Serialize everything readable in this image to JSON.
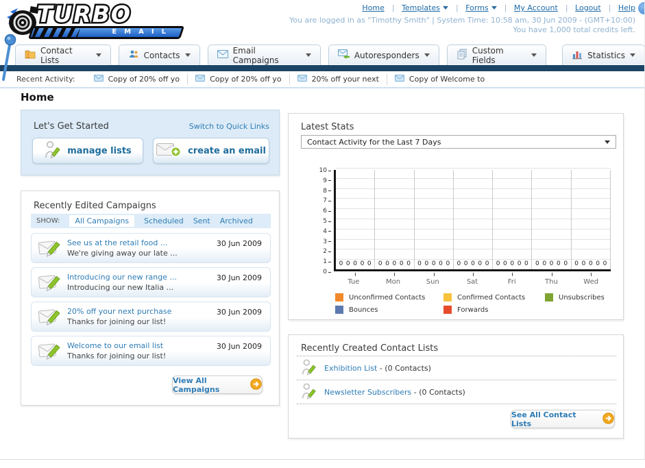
{
  "header": {
    "logo": {
      "line1": "TURBO",
      "line2": "EMAIL"
    },
    "nav": [
      {
        "label": "Home",
        "dropdown": false
      },
      {
        "label": "Templates",
        "dropdown": true
      },
      {
        "label": "Forms",
        "dropdown": true
      },
      {
        "label": "My Account",
        "dropdown": false
      },
      {
        "label": "Logout",
        "dropdown": false
      },
      {
        "label": "Help",
        "dropdown": false
      }
    ],
    "login_info": "You are logged in as \"Timothy Smith\" | System Time: 10:58 am, 30 Jun 2009 - (GMT+10:00)",
    "credits_info": "You have 1,000 total credits left."
  },
  "tabs": [
    {
      "label": "Contact Lists"
    },
    {
      "label": "Contacts"
    },
    {
      "label": "Email Campaigns"
    },
    {
      "label": "Autoresponders"
    },
    {
      "label": "Custom Fields"
    },
    {
      "label": "Statistics"
    }
  ],
  "recent_activity": {
    "label": "Recent Activity:",
    "items": [
      {
        "text": "Copy of 20% off yo"
      },
      {
        "text": "Copy of 20% off yo"
      },
      {
        "text": "20% off your next"
      },
      {
        "text": "Copy of Welcome to"
      }
    ]
  },
  "page_title": "Home",
  "get_started": {
    "title": "Let's Get Started",
    "switch_link": "Switch to Quick Links",
    "manage_lists_label": "manage lists",
    "create_email_label": "create an email"
  },
  "campaigns": {
    "title": "Recently Edited Campaigns",
    "show_label": "SHOW:",
    "filters": [
      {
        "label": "All Campaigns"
      },
      {
        "label": "Scheduled"
      },
      {
        "label": "Sent"
      },
      {
        "label": "Archived"
      }
    ],
    "items": [
      {
        "title": "See us at the retail food ...",
        "subtitle": "We're giving away our late ...",
        "date": "30 Jun 2009"
      },
      {
        "title": "Introducing our new range ...",
        "subtitle": "Introducing our new Italia ...",
        "date": "30 Jun 2009"
      },
      {
        "title": "20% off your next purchase",
        "subtitle": "Thanks for joining our list!",
        "date": "30 Jun 2009"
      },
      {
        "title": "Welcome to our email list",
        "subtitle": "Thanks for joining our list!",
        "date": "30 Jun 2009"
      }
    ],
    "view_all_label": "View All Campaigns"
  },
  "latest_stats": {
    "title": "Latest Stats",
    "dropdown_value": "Contact Activity for the Last 7 Days"
  },
  "chart_data": {
    "type": "bar",
    "title": "Contact Activity for the Last 7 Days",
    "categories": [
      "Tue",
      "Mon",
      "Sun",
      "Sat",
      "Fri",
      "Thu",
      "Wed"
    ],
    "series": [
      {
        "name": "Unconfirmed Contacts",
        "color": "#f28a2b",
        "values": [
          0,
          0,
          0,
          0,
          0,
          0,
          0
        ]
      },
      {
        "name": "Confirmed Contacts",
        "color": "#f6c13d",
        "values": [
          0,
          0,
          0,
          0,
          0,
          0,
          0
        ]
      },
      {
        "name": "Unsubscribes",
        "color": "#7ea432",
        "values": [
          0,
          0,
          0,
          0,
          0,
          0,
          0
        ]
      },
      {
        "name": "Bounces",
        "color": "#5c79b0",
        "values": [
          0,
          0,
          0,
          0,
          0,
          0,
          0
        ]
      },
      {
        "name": "Forwards",
        "color": "#e64c2b",
        "values": [
          0,
          0,
          0,
          0,
          0,
          0,
          0
        ]
      }
    ],
    "xlabel": "",
    "ylabel": "",
    "ylim": [
      0,
      10
    ],
    "yticks": [
      0,
      1,
      2,
      3,
      4,
      5,
      6,
      7,
      8,
      9,
      10
    ],
    "grid": true,
    "legend_position": "bottom"
  },
  "contact_lists": {
    "title": "Recently Created Contact Lists",
    "items": [
      {
        "name": "Exhibition List",
        "count": "- (0 Contacts)"
      },
      {
        "name": "Newsletter Subscribers",
        "count": "- (0 Contacts)"
      }
    ],
    "see_all_label": "See All Contact Lists"
  }
}
